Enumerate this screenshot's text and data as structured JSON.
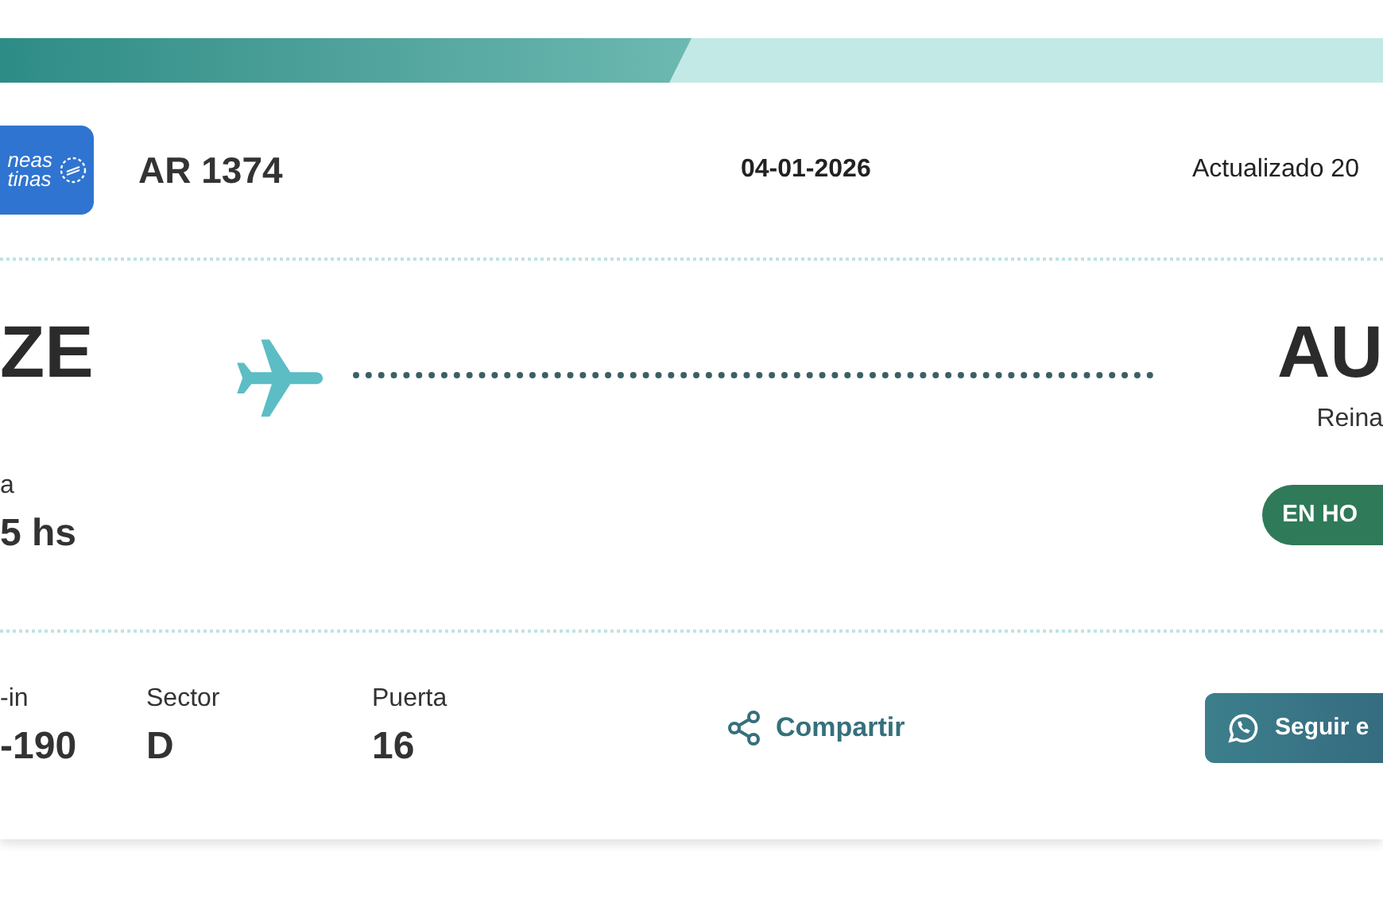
{
  "header": {
    "logo_lines": [
      "neas",
      "tinas"
    ],
    "flight": "AR 1374",
    "date": "04-01-2026",
    "updated": "Actualizado 20"
  },
  "route": {
    "origin": "ZE",
    "destination": "AU",
    "destination_city": "Reina"
  },
  "time": {
    "label": "a",
    "value": "5 hs"
  },
  "status": {
    "label": "EN HO"
  },
  "details": [
    {
      "label": "-in",
      "value": "-190"
    },
    {
      "label": "Sector",
      "value": "D"
    },
    {
      "label": "Puerta",
      "value": "16"
    }
  ],
  "actions": {
    "share": "Compartir",
    "follow": "Seguir e"
  }
}
